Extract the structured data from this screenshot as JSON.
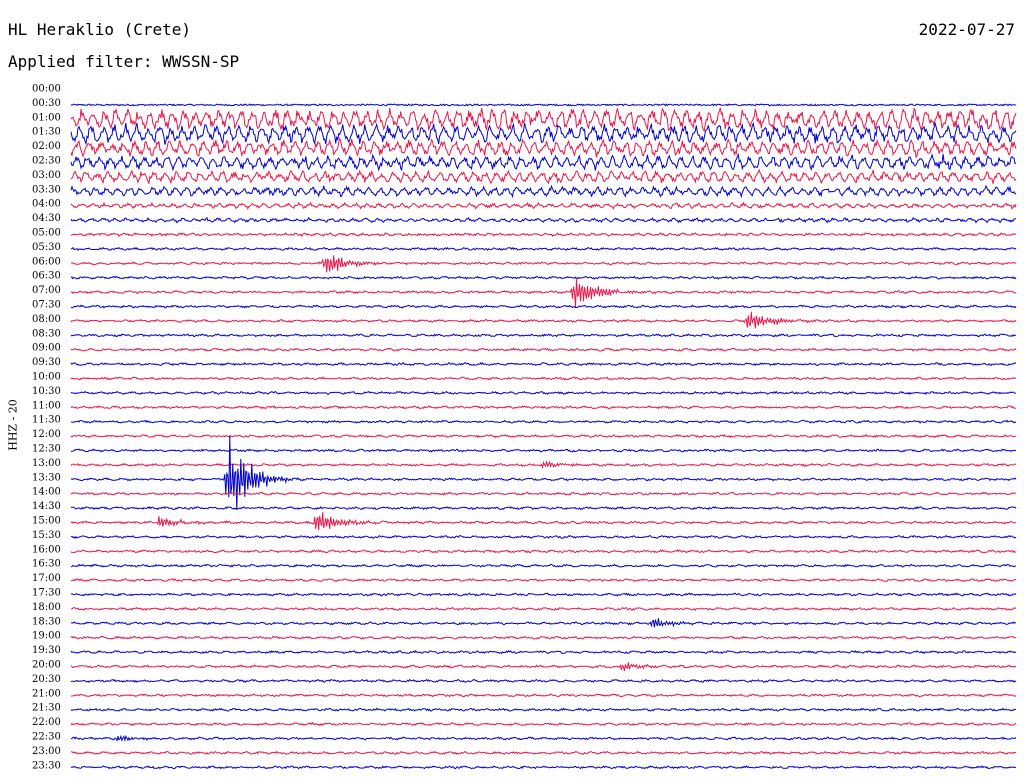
{
  "header": {
    "station": "HL Heraklio (Crete)",
    "date": "2022-07-27",
    "filter": "Applied filter: WWSSN-SP"
  },
  "chart_data": {
    "type": "line",
    "subtype": "helicorder",
    "channel_label": "HHZ - 20",
    "row_labels": [
      "00:00",
      "00:30",
      "01:00",
      "01:30",
      "02:00",
      "02:30",
      "03:00",
      "03:30",
      "04:00",
      "04:30",
      "05:00",
      "05:30",
      "06:00",
      "06:30",
      "07:00",
      "07:30",
      "08:00",
      "08:30",
      "09:00",
      "09:30",
      "10:00",
      "10:30",
      "11:00",
      "11:30",
      "12:00",
      "12:30",
      "13:00",
      "13:30",
      "14:00",
      "14:30",
      "15:00",
      "15:30",
      "16:00",
      "16:30",
      "17:00",
      "17:30",
      "18:00",
      "18:30",
      "19:00",
      "19:30",
      "20:00",
      "20:30",
      "21:00",
      "21:30",
      "22:00",
      "22:30",
      "23:00",
      "23:30"
    ],
    "row_interval_minutes": 30,
    "colors": [
      "#0000cc",
      "#e8174a"
    ],
    "row_color_start": "#e8174a",
    "events": [
      {
        "row": "06:00",
        "minute": 8.1,
        "amplitude": 3.5
      },
      {
        "row": "07:00",
        "minute": 16.0,
        "amplitude": 4.5
      },
      {
        "row": "08:00",
        "minute": 21.5,
        "amplitude": 3.0
      },
      {
        "row": "13:00",
        "minute": 15.0,
        "amplitude": 1.0
      },
      {
        "row": "13:30",
        "minute": 5.0,
        "amplitude": 11.0
      },
      {
        "row": "15:00",
        "minute": 2.8,
        "amplitude": 1.5
      },
      {
        "row": "15:00",
        "minute": 7.8,
        "amplitude": 3.2
      },
      {
        "row": "18:30",
        "minute": 18.5,
        "amplitude": 1.4
      },
      {
        "row": "20:00",
        "minute": 17.5,
        "amplitude": 1.1
      },
      {
        "row": "22:30",
        "minute": 1.5,
        "amplitude": 0.8
      }
    ]
  }
}
